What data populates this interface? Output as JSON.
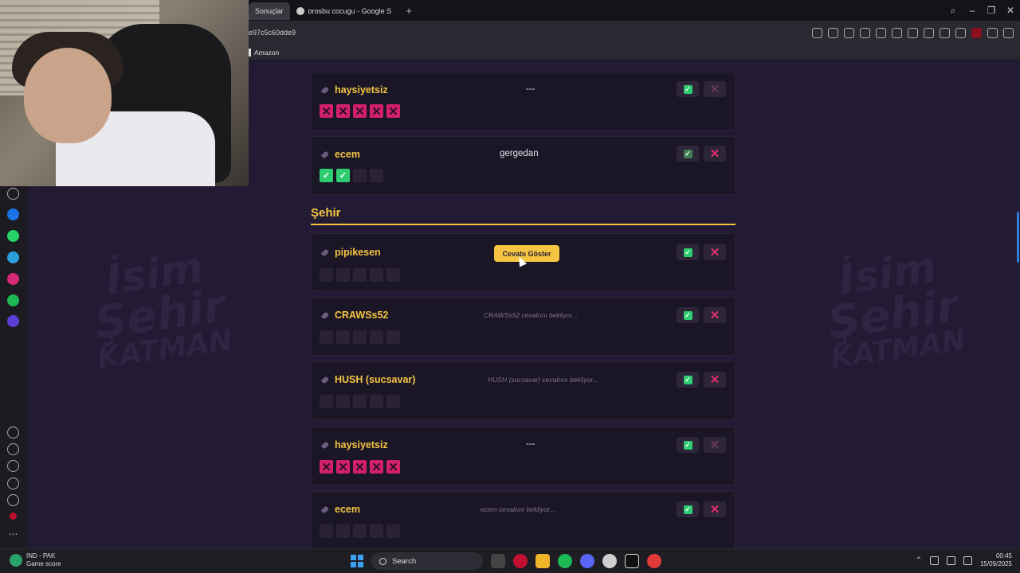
{
  "browser": {
    "tabs": [
      {
        "label": "Sonuçlar",
        "active": true
      },
      {
        "label": "orosbu cocugu - Google S",
        "active": false
      }
    ],
    "url": "e97c5c60dde9",
    "bookmarks": [
      "Amazon"
    ]
  },
  "game": {
    "background_logo": [
      "İsim",
      "Şehir",
      "KATMAN"
    ],
    "top_cards": [
      {
        "player": "haysiyetsiz",
        "answer": "---",
        "votes": [
          "no",
          "no",
          "no",
          "no",
          "no"
        ],
        "approve_dim": false,
        "reject_dim": true
      },
      {
        "player": "ecem",
        "answer": "gergedan",
        "votes": [
          "yes",
          "yes",
          "empty",
          "empty"
        ],
        "approve_dim": true,
        "reject_dim": false
      }
    ],
    "section": {
      "title": "Şehir",
      "reveal_button": "Cevabı Göster",
      "cards": [
        {
          "player": "pipikesen",
          "status": "",
          "votes": [
            "empty",
            "empty",
            "empty",
            "empty",
            "empty"
          ],
          "reject_dim": false
        },
        {
          "player": "CRAWSs52",
          "status": "CRAWSs52 cevabını bekliyor...",
          "votes": [
            "empty",
            "empty",
            "empty",
            "empty",
            "empty"
          ],
          "reject_dim": false
        },
        {
          "player": "HUSH (sucsavar)",
          "status": "HUSH (sucsavar) cevabını bekliyor...",
          "votes": [
            "empty",
            "empty",
            "empty",
            "empty",
            "empty"
          ],
          "reject_dim": false
        },
        {
          "player": "haysiyetsiz",
          "status": "---",
          "votes": [
            "no",
            "no",
            "no",
            "no",
            "no"
          ],
          "reject_dim": true
        },
        {
          "player": "ecem",
          "status": "ecem cevabını bekliyor...",
          "votes": [
            "empty",
            "empty",
            "empty",
            "empty",
            "empty"
          ],
          "reject_dim": false
        }
      ]
    }
  },
  "taskbar": {
    "game_score_title": "IND - PAK",
    "game_score_label": "Game score",
    "search_label": "Search",
    "time": "00:45",
    "date": "15/09/2025"
  },
  "colors": {
    "accent": "#f5c542",
    "approve": "#2ecc71",
    "reject": "#e22c6c",
    "background": "#231a33"
  }
}
